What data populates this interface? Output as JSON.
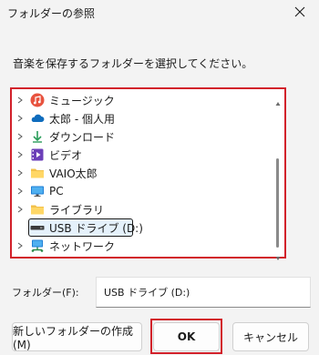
{
  "dialog": {
    "title": "フォルダーの参照",
    "instruction": "音楽を保存するフォルダーを選択してください。"
  },
  "tree": {
    "items": [
      {
        "label": "ミュージック",
        "icon": "music-icon",
        "expandable": true
      },
      {
        "label": "太郎 - 個人用",
        "icon": "cloud-icon",
        "expandable": true
      },
      {
        "label": "ダウンロード",
        "icon": "download-icon",
        "expandable": true
      },
      {
        "label": "ビデオ",
        "icon": "video-icon",
        "expandable": true
      },
      {
        "label": "VAIO太郎",
        "icon": "folder-icon",
        "expandable": true
      },
      {
        "label": "PC",
        "icon": "pc-icon",
        "expandable": true
      },
      {
        "label": "ライブラリ",
        "icon": "folder-icon",
        "expandable": true
      },
      {
        "label": "USB ドライブ (D:)",
        "icon": "usb-drive-icon",
        "expandable": false,
        "selected": true
      },
      {
        "label": "ネットワーク",
        "icon": "network-icon",
        "expandable": true
      }
    ]
  },
  "folder": {
    "label": "フォルダー(F):",
    "value": "USB ドライブ (D:)"
  },
  "buttons": {
    "new_folder": "新しいフォルダーの作成(M)",
    "ok": "OK",
    "cancel": "キャンセル"
  },
  "colors": {
    "highlight_outline": "#d2202a",
    "selection_bg": "#e5f1fb"
  }
}
